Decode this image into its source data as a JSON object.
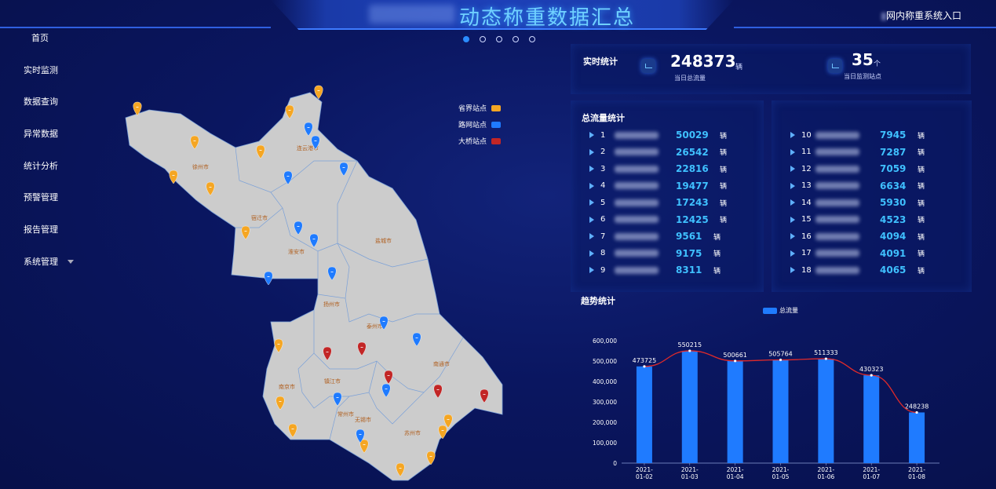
{
  "header": {
    "title": "动态称重数据汇总",
    "entry_link": "网内称重系统入口"
  },
  "sidebar": {
    "items": [
      {
        "label": "首页"
      },
      {
        "label": "实时监测"
      },
      {
        "label": "数据查询"
      },
      {
        "label": "异常数据"
      },
      {
        "label": "统计分析"
      },
      {
        "label": "预警管理"
      },
      {
        "label": "报告管理"
      },
      {
        "label": "系统管理"
      }
    ]
  },
  "map": {
    "legend": [
      {
        "label": "省界站点",
        "color": "#f5a623"
      },
      {
        "label": "路网站点",
        "color": "#1f7bff"
      },
      {
        "label": "大桥站点",
        "color": "#c22626"
      }
    ],
    "cities": [
      "徐州市",
      "连云港市",
      "宿迁市",
      "淮安市",
      "盐城市",
      "扬州市",
      "泰州市",
      "南通市",
      "南京市",
      "镇江市",
      "常州市",
      "无锡市",
      "苏州市"
    ]
  },
  "realtime": {
    "title": "实时统计",
    "total_flow": "248373",
    "total_flow_unit": "辆",
    "total_flow_caption": "当日总流量",
    "stations": "35",
    "stations_unit": "个",
    "stations_caption": "当日监测站点"
  },
  "ranking": {
    "title": "总流量统计",
    "unit": "辆",
    "left": [
      {
        "idx": "1",
        "value": "50029"
      },
      {
        "idx": "2",
        "value": "26542"
      },
      {
        "idx": "3",
        "value": "22816"
      },
      {
        "idx": "4",
        "value": "19477"
      },
      {
        "idx": "5",
        "value": "17243"
      },
      {
        "idx": "6",
        "value": "12425"
      },
      {
        "idx": "7",
        "value": "9561"
      },
      {
        "idx": "8",
        "value": "9175"
      },
      {
        "idx": "9",
        "value": "8311"
      }
    ],
    "right": [
      {
        "idx": "10",
        "value": "7945"
      },
      {
        "idx": "11",
        "value": "7287"
      },
      {
        "idx": "12",
        "value": "7059"
      },
      {
        "idx": "13",
        "value": "6634"
      },
      {
        "idx": "14",
        "value": "5930"
      },
      {
        "idx": "15",
        "value": "4523"
      },
      {
        "idx": "16",
        "value": "4094"
      },
      {
        "idx": "17",
        "value": "4091"
      },
      {
        "idx": "18",
        "value": "4065"
      }
    ]
  },
  "trend": {
    "title": "趋势统计",
    "legend": "总流量"
  },
  "chart_data": {
    "type": "bar",
    "categories": [
      "2021-01-02",
      "2021-01-03",
      "2021-01-04",
      "2021-01-05",
      "2021-01-06",
      "2021-01-07",
      "2021-01-08"
    ],
    "series": [
      {
        "name": "总流量",
        "values": [
          473725,
          550215,
          500661,
          505764,
          511333,
          430323,
          248238
        ]
      }
    ],
    "overlay_line": true,
    "ylim": [
      0,
      600000
    ],
    "yticks": [
      "0",
      "100,000",
      "200,000",
      "300,000",
      "400,000",
      "500,000",
      "600,000"
    ],
    "bar_color": "#1f7bff",
    "line_color": "#e02a2a"
  }
}
